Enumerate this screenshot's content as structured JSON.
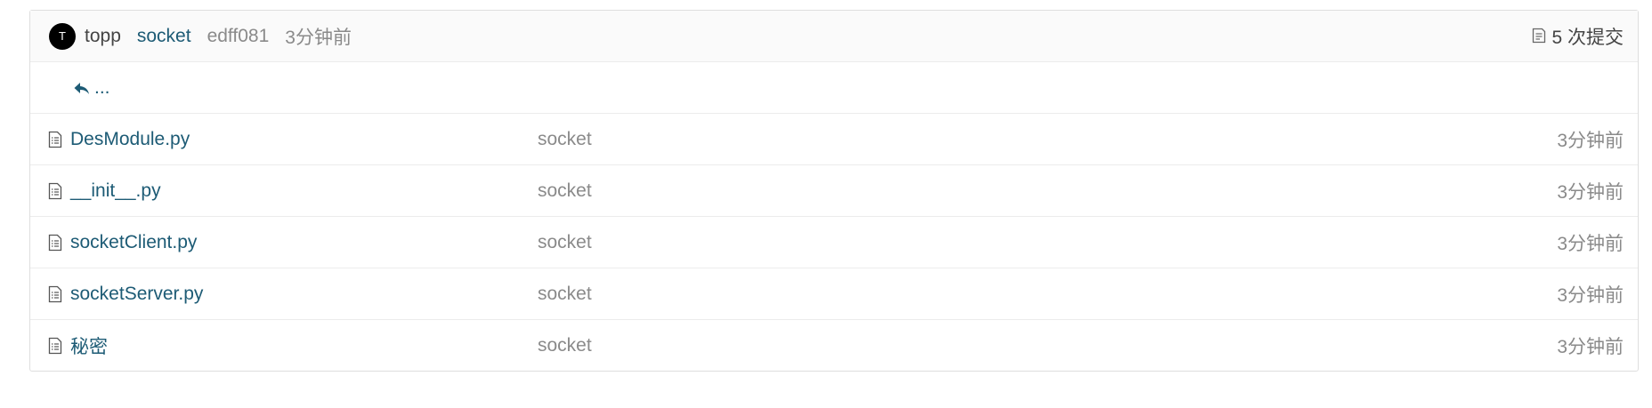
{
  "latest_commit": {
    "avatar_letter": "T",
    "author": "topp",
    "message": "socket",
    "sha": "edff081",
    "time": "3分钟前",
    "commits_label": "5 次提交"
  },
  "back": {
    "label": "..."
  },
  "files": [
    {
      "name": "DesModule.py",
      "message": "socket",
      "age": "3分钟前",
      "icon": "file-icon"
    },
    {
      "name": "__init__.py",
      "message": "socket",
      "age": "3分钟前",
      "icon": "file-icon"
    },
    {
      "name": "socketClient.py",
      "message": "socket",
      "age": "3分钟前",
      "icon": "file-icon"
    },
    {
      "name": "socketServer.py",
      "message": "socket",
      "age": "3分钟前",
      "icon": "file-icon"
    },
    {
      "name": "秘密",
      "message": "socket",
      "age": "3分钟前",
      "icon": "file-icon"
    }
  ],
  "colors": {
    "link": "#1d5b75",
    "muted": "#8a8a8a",
    "header_bg": "#fafafa",
    "border": "#dedede"
  }
}
